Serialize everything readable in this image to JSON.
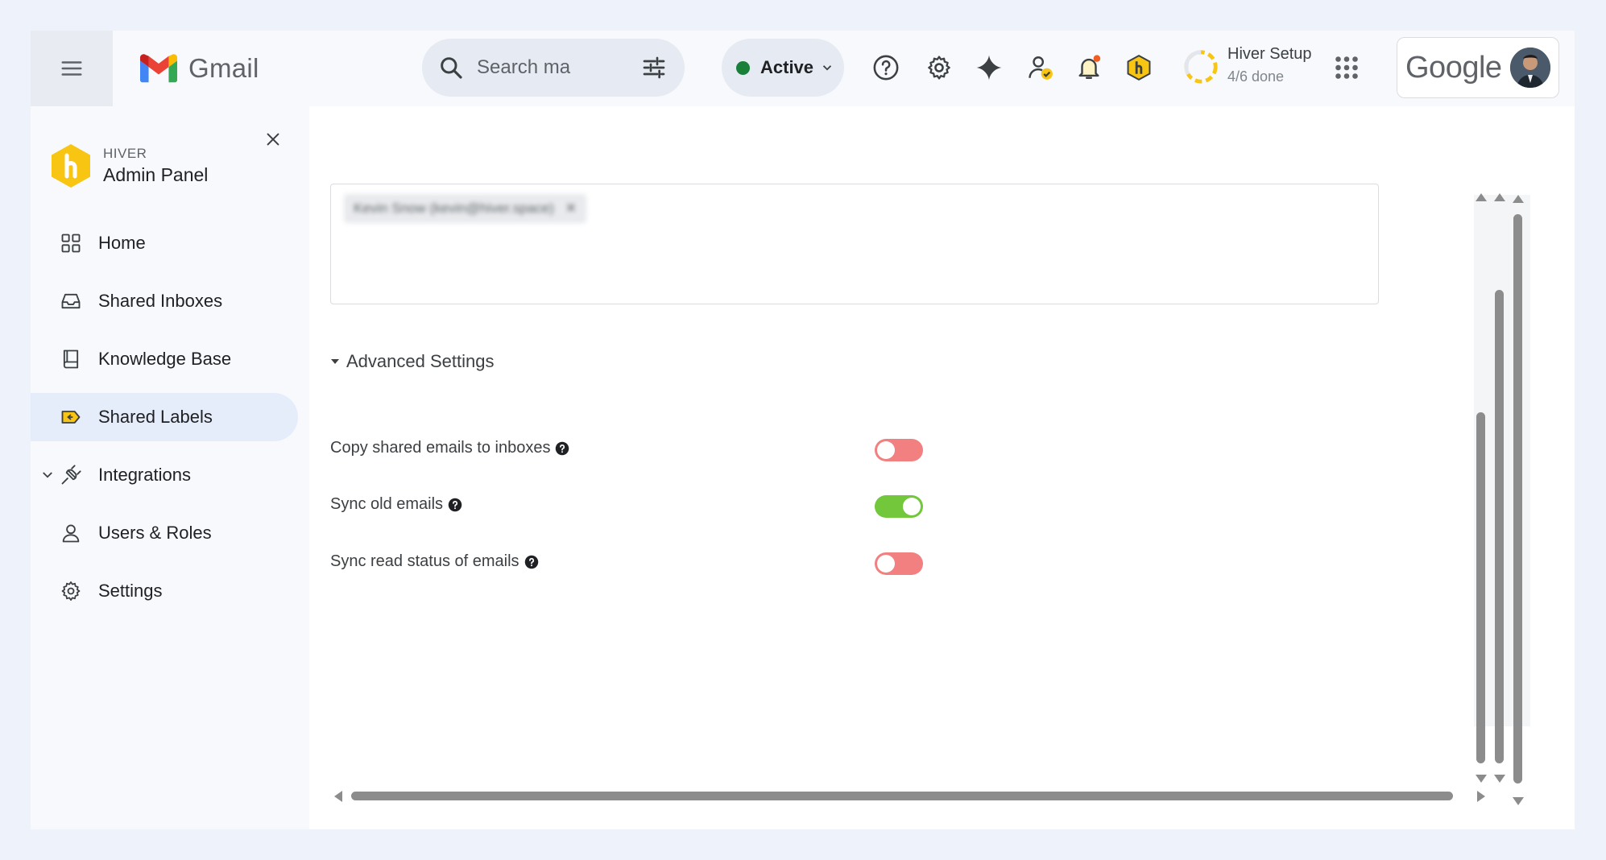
{
  "header": {
    "app_name": "Gmail",
    "search_placeholder": "Search ma",
    "status_label": "Active",
    "setup_title": "Hiver Setup",
    "setup_progress": "4/6 done",
    "setup_fraction": 0.6667,
    "google_logo_text": "Google",
    "icons": [
      "menu-icon",
      "gmail-logo-icon",
      "search-icon",
      "filter-icon",
      "status-dot",
      "help-icon",
      "gear-icon",
      "sparkle-icon",
      "user-check-icon",
      "bell-icon",
      "hiver-icon",
      "setup-progress-ring",
      "apps-grid-icon",
      "avatar"
    ]
  },
  "sidebar": {
    "brand_small": "HIVER",
    "brand_title": "Admin Panel",
    "items": [
      {
        "label": "Home",
        "icon": "grid-icon"
      },
      {
        "label": "Shared Inboxes",
        "icon": "inbox-icon"
      },
      {
        "label": "Knowledge Base",
        "icon": "book-icon"
      },
      {
        "label": "Shared Labels",
        "icon": "label-icon",
        "active": true
      },
      {
        "label": "Integrations",
        "icon": "plug-icon",
        "expandable": true
      },
      {
        "label": "Users & Roles",
        "icon": "user-icon"
      },
      {
        "label": "Settings",
        "icon": "gear-icon"
      }
    ]
  },
  "main": {
    "chip_text": "Kevin Snow (kevin@hiver.space)",
    "advanced_settings_label": "Advanced Settings",
    "settings": [
      {
        "label": "Copy shared emails to inboxes",
        "enabled": false
      },
      {
        "label": "Sync old emails",
        "enabled": true
      },
      {
        "label": "Sync read status of emails",
        "enabled": false
      }
    ]
  },
  "colors": {
    "toggle_on": "#72c73a",
    "toggle_off": "#f28080",
    "active_nav_bg": "#e6edfa",
    "status_green": "#188038",
    "hiver_yellow": "#f9c513"
  }
}
